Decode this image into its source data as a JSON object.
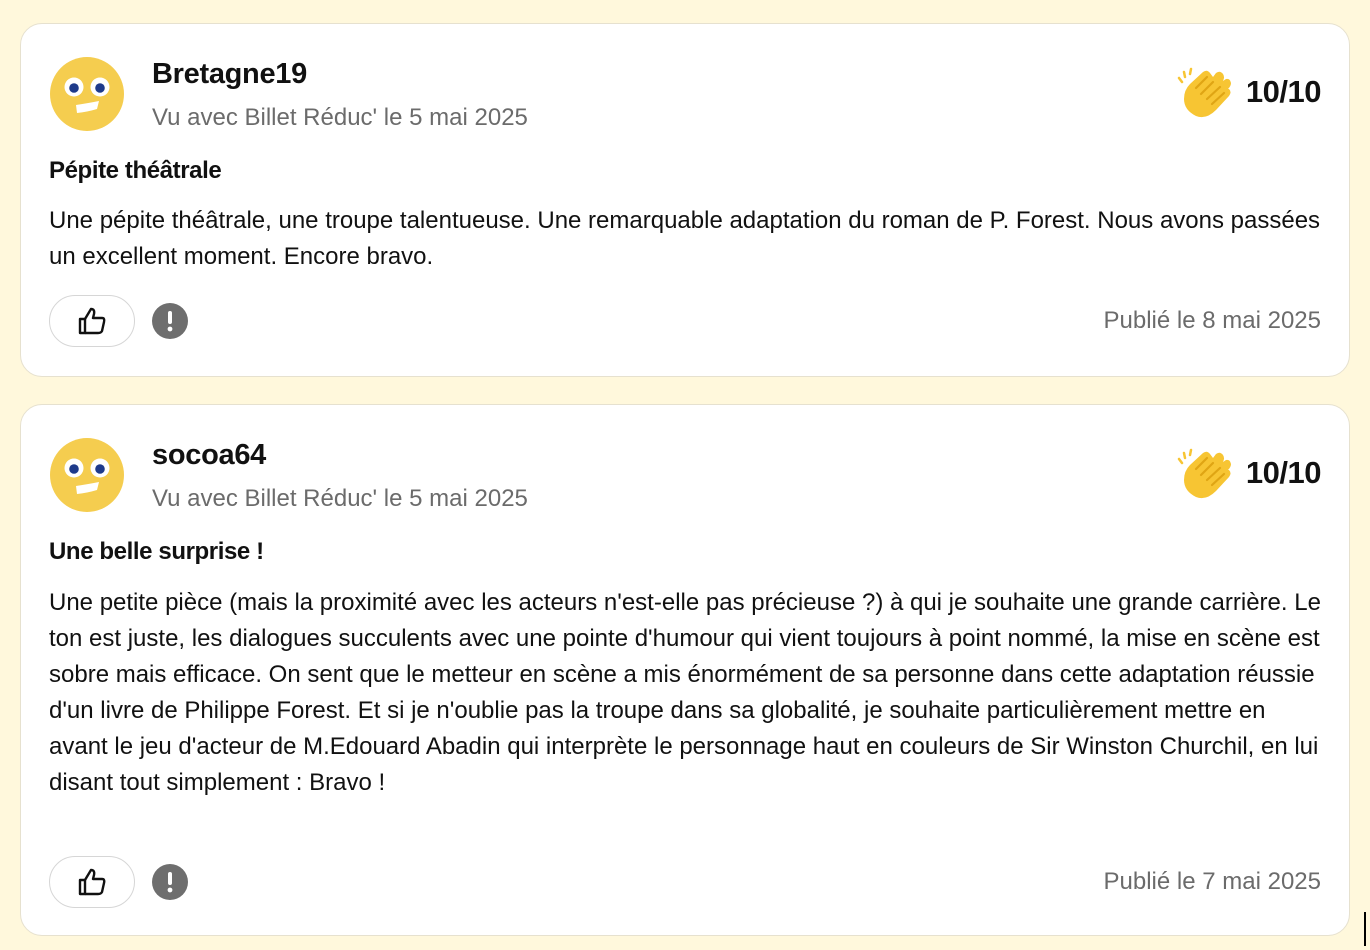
{
  "colors": {
    "page_background": "#fff8dc",
    "card_background": "#ffffff",
    "muted_text": "#6b6b6b",
    "avatar_yellow": "#f5cd4f",
    "clap_yellow": "#f7c533"
  },
  "reviews": [
    {
      "username": "Bretagne19",
      "seen_text": "Vu avec Billet Réduc' le 5 mai 2025",
      "score": "10/10",
      "title": "Pépite théâtrale",
      "body": "Une pépite théâtrale, une troupe talentueuse. Une remarquable adaptation du roman de P. Forest. Nous avons passées un excellent moment. Encore bravo.",
      "published": "Publié le 8 mai 2025",
      "avatar_icon": "smiley-avatar-icon",
      "score_icon": "clapping-hands-icon",
      "like_icon": "thumbs-up-icon",
      "report_icon": "exclamation-icon"
    },
    {
      "username": "socoa64",
      "seen_text": "Vu avec Billet Réduc' le 5 mai 2025",
      "score": "10/10",
      "title": "Une belle surprise !",
      "body": "Une petite pièce (mais la proximité avec les acteurs n'est-elle pas précieuse ?) à qui je souhaite une grande carrière. Le ton est juste, les dialogues succulents avec une pointe d'humour qui vient toujours à point nommé, la mise en scène est sobre mais efficace. On sent que le metteur en scène a mis énormément de sa personne dans cette adaptation réussie d'un livre de Philippe Forest. Et si je n'oublie pas la troupe dans sa globalité, je souhaite particulièrement mettre en avant le jeu d'acteur de M.Edouard Abadin qui interprète le personnage haut en couleurs de Sir Winston Churchil, en lui disant tout simplement : Bravo !",
      "published": "Publié le 7 mai 2025",
      "avatar_icon": "smiley-avatar-icon",
      "score_icon": "clapping-hands-icon",
      "like_icon": "thumbs-up-icon",
      "report_icon": "exclamation-icon"
    }
  ]
}
